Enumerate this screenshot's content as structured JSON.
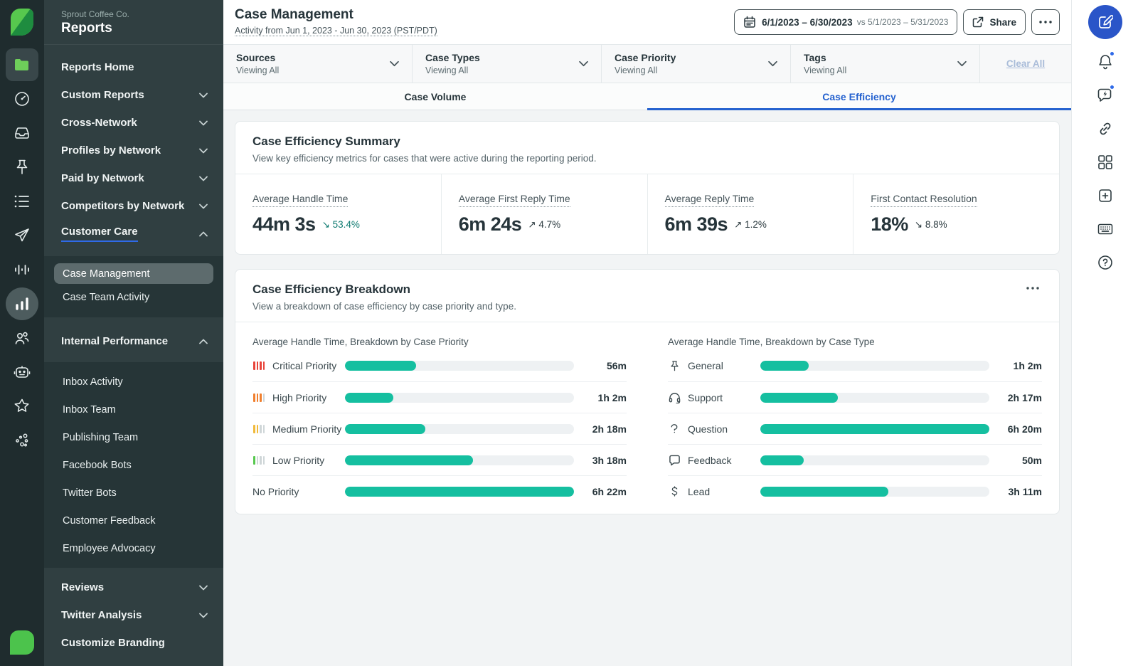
{
  "colors": {
    "teal_bar": "#15BFA0",
    "accent_blue": "#2562CF",
    "badge_blue": "#2F6AE8",
    "delta_teal": "#0D7A70",
    "critical_red": "#E8443A",
    "high_orange": "#F07F2E",
    "medium_yellow": "#F0B93A",
    "low_green": "#57C84E",
    "sidebar_bg": "#303F41",
    "rail_bg": "#1F2C2E",
    "logo_green": "#4CC34C"
  },
  "rail": {
    "icons": [
      "sprout-logo",
      "folder",
      "gauge",
      "inbox",
      "pin",
      "list",
      "send",
      "waveform",
      "bar-chart",
      "people",
      "bot",
      "star",
      "molecule",
      "sprout-leaf"
    ]
  },
  "sidebar": {
    "company": "Sprout Coffee Co.",
    "title": "Reports",
    "home": "Reports Home",
    "top_items": [
      "Custom Reports",
      "Cross-Network",
      "Profiles by Network",
      "Paid by Network",
      "Competitors by Network"
    ],
    "customer_care": "Customer Care",
    "care_children": [
      "Case Management",
      "Case Team Activity"
    ],
    "active_child": "Case Management",
    "internal": "Internal Performance",
    "internal_children": [
      "Inbox Activity",
      "Inbox Team",
      "Publishing Team",
      "Facebook Bots",
      "Twitter Bots",
      "Customer Feedback",
      "Employee Advocacy"
    ],
    "footer_items": [
      "Reviews",
      "Twitter Analysis",
      "Customize Branding"
    ]
  },
  "header": {
    "title": "Case Management",
    "subtitle": "Activity from Jun 1, 2023 - Jun 30, 2023 (PST/PDT)",
    "date_range": "6/1/2023 – 6/30/2023",
    "compare_range": "vs 5/1/2023 – 5/31/2023",
    "share": "Share"
  },
  "filters": {
    "items": [
      {
        "label": "Sources",
        "value": "Viewing All"
      },
      {
        "label": "Case Types",
        "value": "Viewing All"
      },
      {
        "label": "Case Priority",
        "value": "Viewing All"
      },
      {
        "label": "Tags",
        "value": "Viewing All"
      }
    ],
    "clear_all": "Clear All"
  },
  "tabs": {
    "volume": "Case Volume",
    "efficiency": "Case Efficiency"
  },
  "summary": {
    "title": "Case Efficiency Summary",
    "subtitle": "View key efficiency metrics for cases that were active during the reporting period.",
    "metrics": [
      {
        "label": "Average Handle Time",
        "value": "44m 3s",
        "delta": "↘ 53.4%",
        "trend": "down"
      },
      {
        "label": "Average First Reply Time",
        "value": "6m 24s",
        "delta": "↗ 4.7%",
        "trend": "up"
      },
      {
        "label": "Average Reply Time",
        "value": "6m 39s",
        "delta": "↗ 1.2%",
        "trend": "up"
      },
      {
        "label": "First Contact Resolution",
        "value": "18%",
        "delta": "↘ 8.8%",
        "trend": "down"
      }
    ]
  },
  "breakdown": {
    "title": "Case Efficiency Breakdown",
    "subtitle": "View a breakdown of case efficiency by case priority and type.",
    "priority_chart": {
      "title": "Average Handle Time, Breakdown by Case Priority",
      "rows": [
        {
          "icon": "priority-critical-icon",
          "label": "Critical Priority",
          "value": "56m",
          "pct": "31%"
        },
        {
          "icon": "priority-high-icon",
          "label": "High Priority",
          "value": "1h 2m",
          "pct": "21%"
        },
        {
          "icon": "priority-medium-icon",
          "label": "Medium Priority",
          "value": "2h 18m",
          "pct": "35%"
        },
        {
          "icon": "priority-low-icon",
          "label": "Low Priority",
          "value": "3h 18m",
          "pct": "56%"
        },
        {
          "icon": null,
          "label": "No Priority",
          "value": "6h 22m",
          "pct": "100%"
        }
      ]
    },
    "type_chart": {
      "title": "Average Handle Time, Breakdown by Case Type",
      "rows": [
        {
          "icon": "pin-icon",
          "label": "General",
          "value": "1h 2m",
          "pct": "21%"
        },
        {
          "icon": "headset-icon",
          "label": "Support",
          "value": "2h 17m",
          "pct": "34%"
        },
        {
          "icon": "question-icon",
          "label": "Question",
          "value": "6h 20m",
          "pct": "100%"
        },
        {
          "icon": "feedback-icon",
          "label": "Feedback",
          "value": "50m",
          "pct": "19%"
        },
        {
          "icon": "dollar-icon",
          "label": "Lead",
          "value": "3h 11m",
          "pct": "56%"
        }
      ]
    }
  },
  "chart_data": [
    {
      "type": "bar",
      "orientation": "horizontal",
      "title": "Average Handle Time, Breakdown by Case Priority",
      "categories": [
        "Critical Priority",
        "High Priority",
        "Medium Priority",
        "Low Priority",
        "No Priority"
      ],
      "values_minutes": [
        56,
        62,
        138,
        198,
        382
      ],
      "value_labels": [
        "56m",
        "1h 2m",
        "2h 18m",
        "3h 18m",
        "6h 22m"
      ]
    },
    {
      "type": "bar",
      "orientation": "horizontal",
      "title": "Average Handle Time, Breakdown by Case Type",
      "categories": [
        "General",
        "Support",
        "Question",
        "Feedback",
        "Lead"
      ],
      "values_minutes": [
        62,
        137,
        380,
        50,
        191
      ],
      "value_labels": [
        "1h 2m",
        "2h 17m",
        "6h 20m",
        "50m",
        "3h 11m"
      ]
    }
  ],
  "right_rail": {
    "icons": [
      "compose",
      "bell",
      "feedback-bolt",
      "link",
      "grid",
      "add-square",
      "keyboard",
      "help"
    ]
  }
}
